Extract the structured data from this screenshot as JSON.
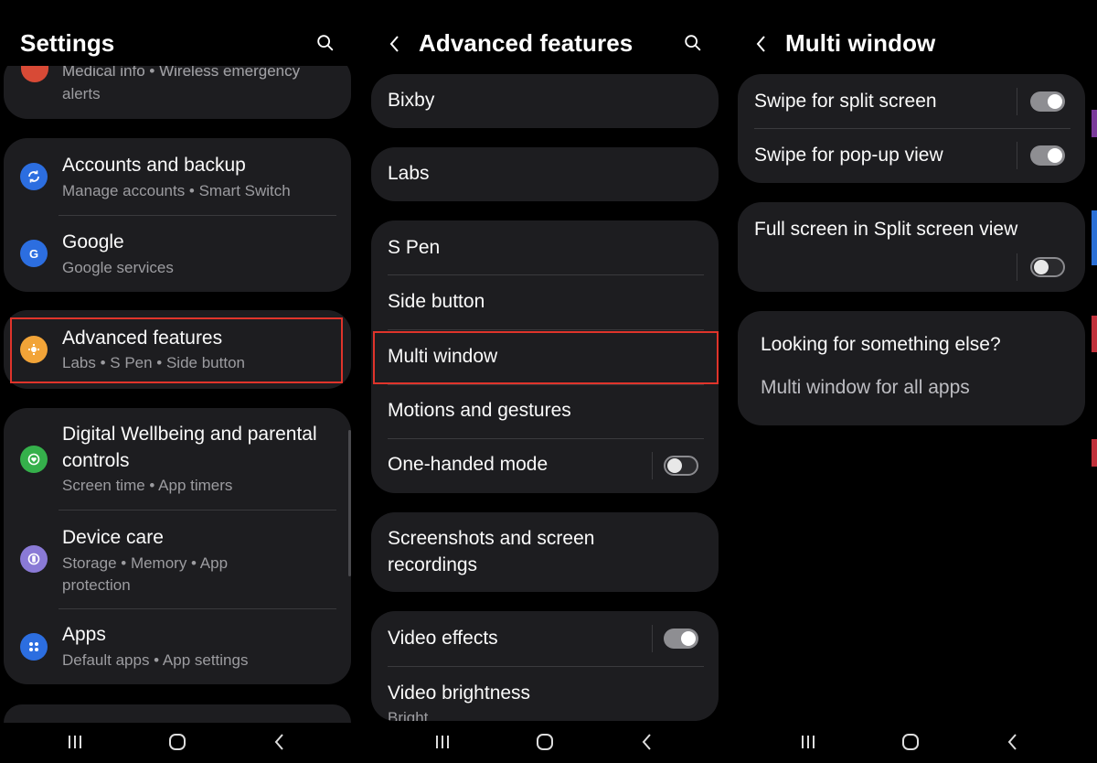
{
  "colors": {
    "highlight": "#e0342b",
    "card": "#1d1d20",
    "accent_blue": "#2c6ee0",
    "accent_orange": "#f2a438",
    "accent_green": "#35b04b",
    "accent_purple": "#8a7ad6"
  },
  "settings": {
    "title": "Settings",
    "partial_item": {
      "title": "Medical info • Wireless emergency",
      "subtitle": "alerts"
    },
    "items": [
      {
        "title": "Accounts and backup",
        "subtitle": "Manage accounts  •  Smart Switch",
        "icon": "sync-icon"
      },
      {
        "title": "Google",
        "subtitle": "Google services",
        "icon": "google-icon"
      },
      {
        "title": "Advanced features",
        "subtitle": "Labs  •  S Pen  •  Side button",
        "icon": "advanced-icon"
      },
      {
        "title": "Digital Wellbeing and parental",
        "title2": "controls",
        "subtitle": "Screen time  •  App timers",
        "icon": "wellbeing-icon"
      },
      {
        "title": "Device care",
        "subtitle": "Storage  •  Memory  •  App",
        "subtitle2": "protection",
        "icon": "device-care-icon"
      },
      {
        "title": "Apps",
        "subtitle": "Default apps  •  App settings",
        "icon": "apps-icon"
      }
    ]
  },
  "advanced": {
    "title": "Advanced features",
    "items": [
      "Bixby",
      "Labs",
      "S Pen",
      "Side button",
      "Multi window",
      "Motions and gestures",
      "One-handed mode"
    ],
    "screenshots": {
      "line1": "Screenshots and screen",
      "line2": "recordings"
    },
    "video_effects": "Video effects",
    "video_brightness": "Video brightness",
    "video_brightness_sub": "Bright"
  },
  "multi": {
    "title": "Multi window",
    "swipe_split": "Swipe for split screen",
    "swipe_popup": "Swipe for pop-up view",
    "full_screen": "Full screen in Split screen view",
    "looking": "Looking for something else?",
    "link": "Multi window for all apps"
  },
  "toggles": {
    "one_handed": false,
    "video_effects": true,
    "swipe_split": true,
    "swipe_popup": true,
    "full_screen": false
  }
}
